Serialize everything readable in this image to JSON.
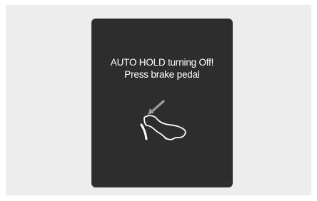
{
  "display": {
    "message_line1": "AUTO HOLD turning Off!",
    "message_line2": "Press brake pedal",
    "icon": "brake-pedal-press-icon",
    "background_color": "#2d2d2d",
    "text_color": "#ffffff",
    "icon_color": "#ffffff",
    "arrow_color": "#9a9a9a"
  }
}
